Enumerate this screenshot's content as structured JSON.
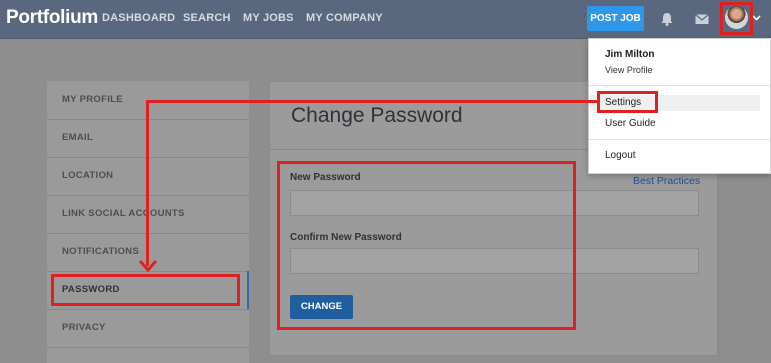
{
  "header": {
    "logo": "Portfolium",
    "nav": [
      "DASHBOARD",
      "SEARCH",
      "MY JOBS",
      "MY COMPANY"
    ],
    "post_job": "POST JOB",
    "icons": [
      "bell-icon",
      "mail-icon",
      "avatar",
      "chevron-down-icon"
    ]
  },
  "dropdown": {
    "name": "Jim Milton",
    "view_profile": "View Profile",
    "items": [
      "Settings",
      "User Guide",
      "Logout"
    ]
  },
  "sidebar": {
    "items": [
      "MY PROFILE",
      "EMAIL",
      "LOCATION",
      "LINK SOCIAL ACCOUNTS",
      "NOTIFICATIONS",
      "PASSWORD",
      "PRIVACY"
    ],
    "active": "PASSWORD"
  },
  "main": {
    "title": "Change Password",
    "best_practices": "Best Practices",
    "new_password_label": "New Password",
    "confirm_password_label": "Confirm New Password",
    "change_button": "CHANGE"
  },
  "colors": {
    "nav_bg": "#59687f",
    "accent": "#2f97ea",
    "annotation": "#e0201e"
  }
}
